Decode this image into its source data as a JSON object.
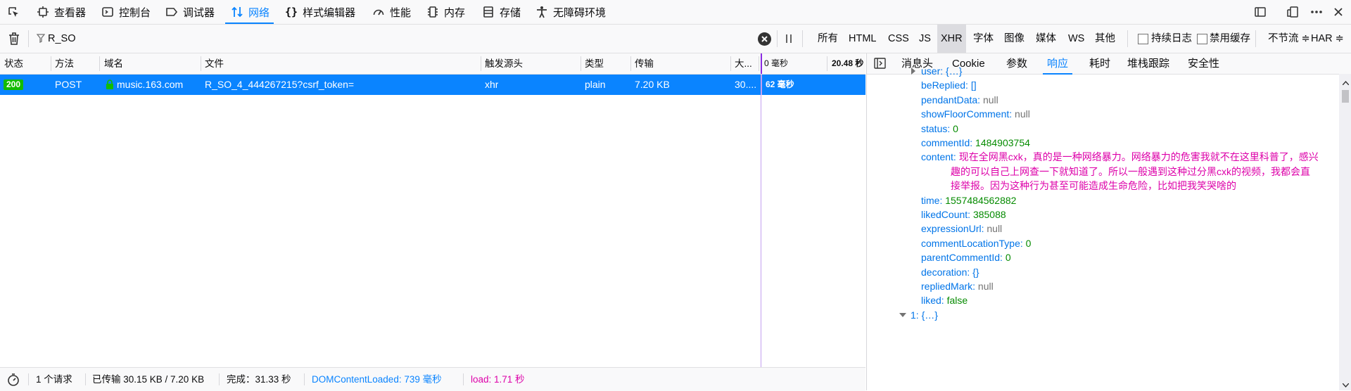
{
  "toolbar": {
    "tools": [
      "查看器",
      "控制台",
      "调试器",
      "网络",
      "样式编辑器",
      "性能",
      "内存",
      "存储",
      "无障碍环境"
    ]
  },
  "filter": {
    "value": "R_SO",
    "types": [
      "所有",
      "HTML",
      "CSS",
      "JS",
      "XHR",
      "字体",
      "图像",
      "媒体",
      "WS",
      "其他"
    ],
    "persist_log": "持续日志",
    "disable_cache": "禁用缓存",
    "throttle": "不节流 ≑",
    "har": "HAR ≑"
  },
  "table": {
    "headers": [
      "状态",
      "方法",
      "域名",
      "文件",
      "触发源头",
      "类型",
      "传输",
      "大...",
      "0 毫秒",
      "20.48 秒"
    ],
    "row": {
      "status": "200",
      "method": "POST",
      "domain": "music.163.com",
      "file": "R_SO_4_444267215?csrf_token=",
      "cause": "xhr",
      "type": "plain",
      "transferred": "7.20 KB",
      "size": "30....",
      "timing": "62 毫秒"
    }
  },
  "statusbar": {
    "requests": "1 个请求",
    "transferred": "已传输 30.15 KB / 7.20 KB",
    "finish": "完成：31.33 秒",
    "dom_loaded": "DOMContentLoaded: 739 毫秒",
    "load": "load: 1.71 秒"
  },
  "panel": {
    "tabs": [
      "消息头",
      "Cookie",
      "参数",
      "响应",
      "耗时",
      "堆栈跟踪",
      "安全性"
    ],
    "selected_tab": "响应",
    "props": [
      {
        "key": "user",
        "val": "{…}",
        "kind": "vobj",
        "collapsible": true
      },
      {
        "key": "beReplied",
        "val": "[]",
        "kind": "vobj"
      },
      {
        "key": "pendantData",
        "val": "null",
        "kind": "vnull"
      },
      {
        "key": "showFloorComment",
        "val": "null",
        "kind": "vnull"
      },
      {
        "key": "status",
        "val": "0",
        "kind": "vnum"
      },
      {
        "key": "commentId",
        "val": "1484903754",
        "kind": "vnum"
      },
      {
        "key": "content",
        "val": "现在全网黑cxk，真的是一种网络暴力。网络暴力的危害我就不在这里科普了，感兴",
        "kind": "vstr"
      },
      {
        "key": "",
        "val": "趣的可以自己上网查一下就知道了。所以一般遇到这种过分黑cxk的视频，我都会直",
        "kind": "vstr"
      },
      {
        "key": "",
        "val": "接举报。因为这种行为甚至可能造成生命危险，比如把我笑哭啥的",
        "kind": "vstr"
      },
      {
        "key": "time",
        "val": "1557484562882",
        "kind": "vnum"
      },
      {
        "key": "likedCount",
        "val": "385088",
        "kind": "vnum"
      },
      {
        "key": "expressionUrl",
        "val": "null",
        "kind": "vnull"
      },
      {
        "key": "commentLocationType",
        "val": "0",
        "kind": "vnum"
      },
      {
        "key": "parentCommentId",
        "val": "0",
        "kind": "vnum"
      },
      {
        "key": "decoration",
        "val": "{}",
        "kind": "vobj"
      },
      {
        "key": "repliedMark",
        "val": "null",
        "kind": "vnull"
      },
      {
        "key": "liked",
        "val": "false",
        "kind": "vbool"
      },
      {
        "key": "1",
        "val": "{…}",
        "kind": "vobj",
        "collapsible": true,
        "expanded": true
      }
    ]
  }
}
